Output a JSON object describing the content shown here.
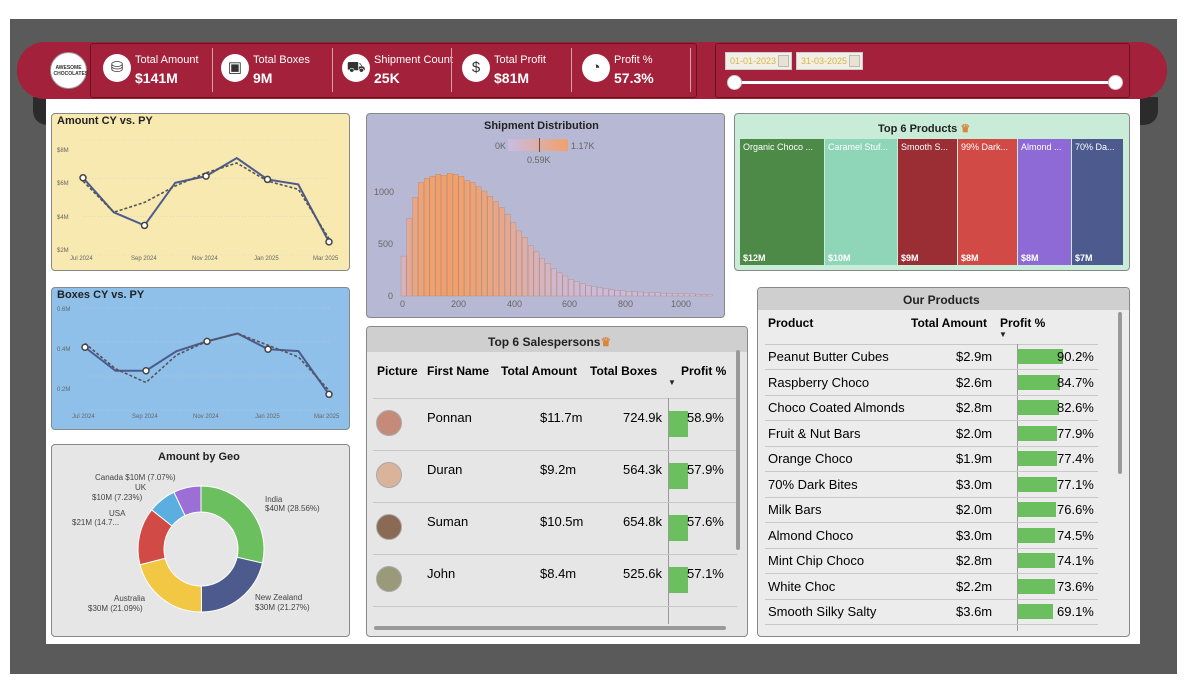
{
  "logo": {
    "text": "AWESOME CHOCOLATES"
  },
  "kpis": [
    {
      "label": "Total Amount",
      "value": "$141M",
      "icon": "coins-icon"
    },
    {
      "label": "Total Boxes",
      "value": "9M",
      "icon": "box-icon"
    },
    {
      "label": "Shipment Count",
      "value": "25K",
      "icon": "truck-icon"
    },
    {
      "label": "Total Profit",
      "value": "$81M",
      "icon": "money-stack-icon"
    },
    {
      "label": "Profit %",
      "value": "57.3%",
      "icon": "gauge-icon"
    }
  ],
  "date_filter": {
    "start": "01-01-2023",
    "end": "31-03-2025"
  },
  "amount_chart": {
    "title": "Amount CY vs. PY",
    "y_ticks": [
      "$8M",
      "$6M",
      "$4M",
      "$2M"
    ],
    "x_ticks": [
      "Jul 2024",
      "Sep 2024",
      "Nov 2024",
      "Jan 2025",
      "Mar 2025"
    ]
  },
  "boxes_chart": {
    "title": "Boxes CY vs. PY",
    "y_ticks": [
      "0.6M",
      "0.4M",
      "0.2M"
    ],
    "x_ticks": [
      "Jul 2024",
      "Sep 2024",
      "Nov 2024",
      "Jan 2025",
      "Mar 2025"
    ]
  },
  "geo_chart": {
    "title": "Amount by Geo",
    "labels": [
      {
        "text": "Canada $10M (7.07%)"
      },
      {
        "text": "UK"
      },
      {
        "text": "$10M (7.23%)"
      },
      {
        "text": "USA"
      },
      {
        "text": "$21M (14.7..."
      },
      {
        "text": "Australia"
      },
      {
        "text": "$30M (21.09%)"
      },
      {
        "text": "India"
      },
      {
        "text": "$40M (28.56%)"
      },
      {
        "text": "New Zealand"
      },
      {
        "text": "$30M (21.27%)"
      }
    ]
  },
  "shipment_chart": {
    "title": "Shipment Distribution",
    "legend_min": "0K",
    "legend_max": "1.17K",
    "legend_mid": "0.59K",
    "y_ticks": [
      "1000",
      "500",
      "0"
    ],
    "x_ticks": [
      "0",
      "200",
      "400",
      "600",
      "800",
      "1000"
    ]
  },
  "top_products": {
    "title": "Top 6 Products",
    "items": [
      {
        "name": "Organic Choco ...",
        "value": "$12M",
        "color": "#4e8a47"
      },
      {
        "name": "Caramel Stuf...",
        "value": "$10M",
        "color": "#8fd6b8"
      },
      {
        "name": "Smooth S...",
        "value": "$9M",
        "color": "#9b2e35"
      },
      {
        "name": "99% Dark...",
        "value": "$8M",
        "color": "#d24a45"
      },
      {
        "name": "Almond ...",
        "value": "$8M",
        "color": "#8e6ad6"
      },
      {
        "name": "70% Da...",
        "value": "$7M",
        "color": "#4c5a8e"
      }
    ]
  },
  "salespersons": {
    "title": "Top 6 Salespersons",
    "headers": [
      "Picture",
      "First Name",
      "Total Amount",
      "Total Boxes",
      "Profit %"
    ],
    "rows": [
      {
        "name": "Ponnan",
        "amount": "$11.7m",
        "boxes": "724.9k",
        "profit": "58.9%",
        "profit_value": 58.9
      },
      {
        "name": "Duran",
        "amount": "$9.2m",
        "boxes": "564.3k",
        "profit": "57.9%",
        "profit_value": 57.9
      },
      {
        "name": "Suman",
        "amount": "$10.5m",
        "boxes": "654.8k",
        "profit": "57.6%",
        "profit_value": 57.6
      },
      {
        "name": "John",
        "amount": "$8.4m",
        "boxes": "525.6k",
        "profit": "57.1%",
        "profit_value": 57.1
      }
    ]
  },
  "our_products": {
    "title": "Our Products",
    "headers": [
      "Product",
      "Total Amount",
      "Profit %"
    ],
    "rows": [
      {
        "product": "Peanut Butter Cubes",
        "amount": "$2.9m",
        "profit": "90.2%",
        "profit_value": 90.2
      },
      {
        "product": "Raspberry Choco",
        "amount": "$2.6m",
        "profit": "84.7%",
        "profit_value": 84.7
      },
      {
        "product": "Choco Coated Almonds",
        "amount": "$2.8m",
        "profit": "82.6%",
        "profit_value": 82.6
      },
      {
        "product": "Fruit & Nut Bars",
        "amount": "$2.0m",
        "profit": "77.9%",
        "profit_value": 77.9
      },
      {
        "product": "Orange Choco",
        "amount": "$1.9m",
        "profit": "77.4%",
        "profit_value": 77.4
      },
      {
        "product": "70% Dark Bites",
        "amount": "$3.0m",
        "profit": "77.1%",
        "profit_value": 77.1
      },
      {
        "product": "Milk Bars",
        "amount": "$2.0m",
        "profit": "76.6%",
        "profit_value": 76.6
      },
      {
        "product": "Almond Choco",
        "amount": "$3.0m",
        "profit": "74.5%",
        "profit_value": 74.5
      },
      {
        "product": "Mint Chip Choco",
        "amount": "$2.8m",
        "profit": "74.1%",
        "profit_value": 74.1
      },
      {
        "product": "White Choc",
        "amount": "$2.2m",
        "profit": "73.6%",
        "profit_value": 73.6
      },
      {
        "product": "Smooth Silky Salty",
        "amount": "$3.6m",
        "profit": "69.1%",
        "profit_value": 69.1
      }
    ]
  },
  "chart_data": [
    {
      "type": "line",
      "title": "Amount CY vs. PY",
      "x": [
        "Jul 2024",
        "Aug 2024",
        "Sep 2024",
        "Oct 2024",
        "Nov 2024",
        "Dec 2024",
        "Jan 2025",
        "Feb 2025",
        "Mar 2025"
      ],
      "series": [
        {
          "values": [
            6.7,
            4.6,
            3.8,
            6.4,
            6.8,
            7.9,
            6.6,
            6.3,
            2.8
          ]
        },
        {
          "values": [
            6.5,
            4.6,
            5.2,
            6.2,
            7.0,
            7.6,
            6.5,
            6.0,
            3.0
          ]
        }
      ],
      "ylim": [
        2,
        9
      ]
    },
    {
      "type": "line",
      "title": "Boxes CY vs. PY",
      "x": [
        "Jul 2024",
        "Aug 2024",
        "Sep 2024",
        "Oct 2024",
        "Nov 2024",
        "Dec 2024",
        "Jan 2025",
        "Feb 2025",
        "Mar 2025"
      ],
      "series": [
        {
          "values": [
            0.42,
            0.3,
            0.3,
            0.4,
            0.45,
            0.49,
            0.41,
            0.4,
            0.18
          ]
        },
        {
          "values": [
            0.44,
            0.31,
            0.24,
            0.38,
            0.45,
            0.49,
            0.43,
            0.37,
            0.2
          ]
        }
      ],
      "ylim": [
        0.1,
        0.62
      ]
    },
    {
      "type": "pie",
      "title": "Amount by Geo",
      "labels": [
        "India",
        "New Zealand",
        "Australia",
        "USA",
        "UK",
        "Canada"
      ],
      "values": [
        28.56,
        21.27,
        21.09,
        14.7,
        7.23,
        7.07
      ],
      "colors": [
        "#6cbf5e",
        "#4c5a8e",
        "#f2c744",
        "#d24a45",
        "#5aaee0",
        "#9b6fd6"
      ]
    },
    {
      "type": "bar",
      "title": "Shipment Distribution",
      "x": [
        0,
        20,
        40,
        60,
        80,
        100,
        120,
        140,
        160,
        180,
        200,
        220,
        240,
        260,
        280,
        300,
        320,
        340,
        360,
        380,
        400,
        420,
        440,
        460,
        480,
        500,
        520,
        540,
        560,
        580,
        600,
        620,
        640,
        660,
        680,
        700,
        720,
        740,
        760,
        780,
        800,
        820,
        840,
        860,
        880,
        900,
        920,
        940,
        960,
        980,
        1000,
        1020,
        1040,
        1060
      ],
      "values": [
        380,
        740,
        940,
        1080,
        1120,
        1140,
        1160,
        1150,
        1170,
        1160,
        1140,
        1100,
        1080,
        1040,
        1000,
        950,
        900,
        840,
        780,
        700,
        620,
        560,
        480,
        420,
        360,
        310,
        260,
        220,
        190,
        160,
        140,
        120,
        100,
        90,
        80,
        70,
        60,
        55,
        50,
        45,
        40,
        38,
        35,
        32,
        30,
        28,
        26,
        24,
        22,
        20,
        20,
        18,
        16,
        15
      ],
      "ylim": [
        0,
        1200
      ]
    },
    {
      "type": "bar",
      "title": "Top 6 Products",
      "categories": [
        "Organic Choco ...",
        "Caramel Stuf...",
        "Smooth S...",
        "99% Dark...",
        "Almond ...",
        "70% Da..."
      ],
      "values": [
        12,
        10,
        9,
        8,
        8,
        7
      ]
    }
  ]
}
